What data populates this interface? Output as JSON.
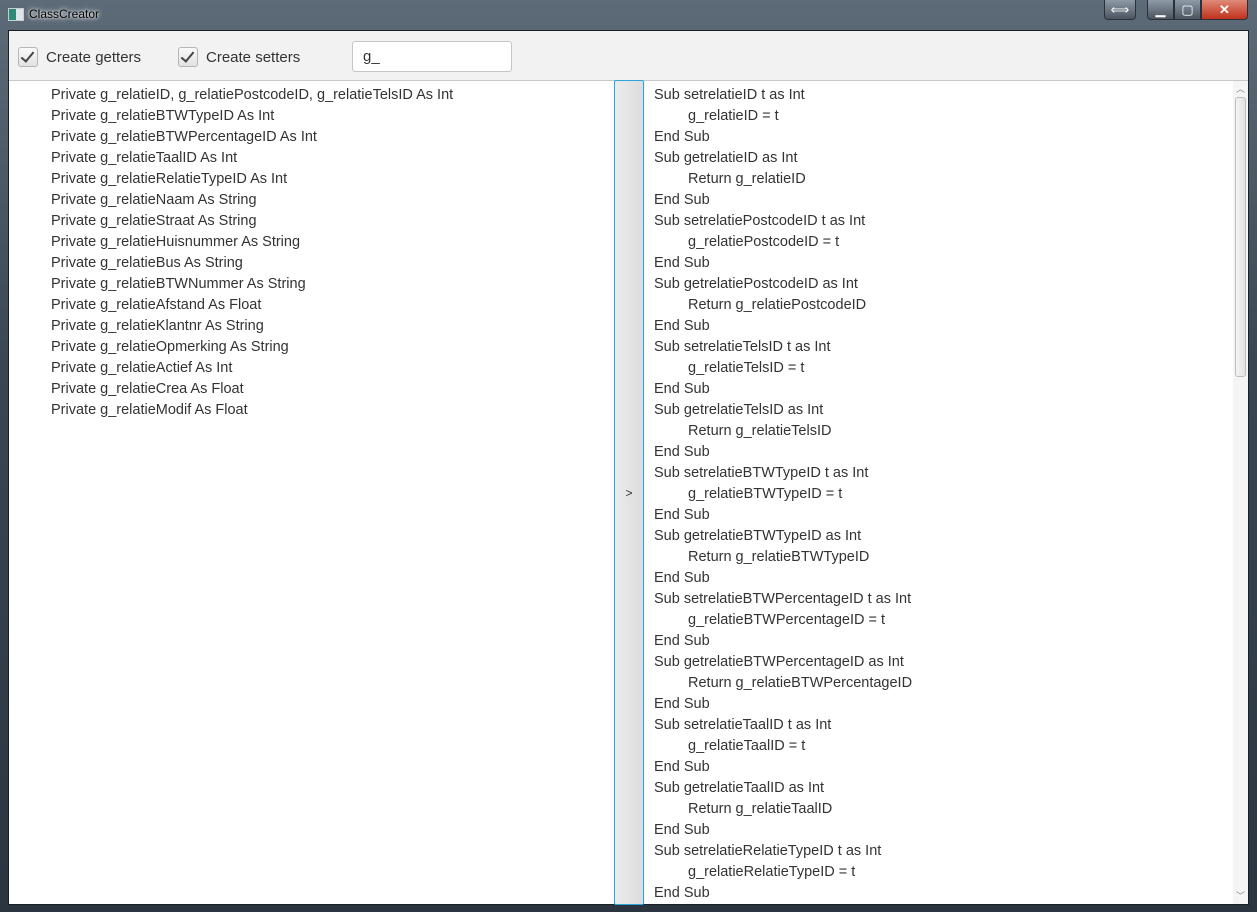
{
  "window": {
    "title": "ClassCreator"
  },
  "toolbar": {
    "getters_label": "Create getters",
    "getters_checked": true,
    "setters_label": "Create setters",
    "setters_checked": true,
    "prefix_value": "g_",
    "run_label": ">"
  },
  "declarations": [
    "Private g_relatieID, g_relatiePostcodeID, g_relatieTelsID As Int",
    "Private g_relatieBTWTypeID As Int",
    "Private g_relatieBTWPercentageID As Int",
    "Private g_relatieTaalID As Int",
    "Private g_relatieRelatieTypeID As Int",
    "Private g_relatieNaam As String",
    "Private g_relatieStraat As String",
    "Private g_relatieHuisnummer As String",
    "Private g_relatieBus As String",
    "Private g_relatieBTWNummer As String",
    "Private g_relatieAfstand As Float",
    "Private g_relatieKlantnr As String",
    "Private g_relatieOpmerking As String",
    "Private g_relatieActief As Int",
    "Private g_relatieCrea As Float",
    "Private g_relatieModif As Float"
  ],
  "output": [
    {
      "t": "Sub setrelatieID t as Int",
      "i": 0
    },
    {
      "t": "g_relatieID = t",
      "i": 1
    },
    {
      "t": "End Sub",
      "i": 0
    },
    {
      "t": "Sub getrelatieID as Int",
      "i": 0
    },
    {
      "t": "Return g_relatieID",
      "i": 1
    },
    {
      "t": "End Sub",
      "i": 0
    },
    {
      "t": "Sub setrelatiePostcodeID t as Int",
      "i": 0
    },
    {
      "t": "g_relatiePostcodeID = t",
      "i": 1
    },
    {
      "t": "End Sub",
      "i": 0
    },
    {
      "t": "Sub getrelatiePostcodeID as Int",
      "i": 0
    },
    {
      "t": "Return g_relatiePostcodeID",
      "i": 1
    },
    {
      "t": "End Sub",
      "i": 0
    },
    {
      "t": "Sub setrelatieTelsID t as Int",
      "i": 0
    },
    {
      "t": "g_relatieTelsID = t",
      "i": 1
    },
    {
      "t": "End Sub",
      "i": 0
    },
    {
      "t": "Sub getrelatieTelsID as Int",
      "i": 0
    },
    {
      "t": "Return g_relatieTelsID",
      "i": 1
    },
    {
      "t": "End Sub",
      "i": 0
    },
    {
      "t": "Sub setrelatieBTWTypeID t as Int",
      "i": 0
    },
    {
      "t": "g_relatieBTWTypeID = t",
      "i": 1
    },
    {
      "t": "End Sub",
      "i": 0
    },
    {
      "t": "Sub getrelatieBTWTypeID as Int",
      "i": 0
    },
    {
      "t": "Return g_relatieBTWTypeID",
      "i": 1
    },
    {
      "t": "End Sub",
      "i": 0
    },
    {
      "t": "Sub setrelatieBTWPercentageID t as Int",
      "i": 0
    },
    {
      "t": "g_relatieBTWPercentageID = t",
      "i": 1
    },
    {
      "t": "End Sub",
      "i": 0
    },
    {
      "t": "Sub getrelatieBTWPercentageID as Int",
      "i": 0
    },
    {
      "t": "Return g_relatieBTWPercentageID",
      "i": 1
    },
    {
      "t": "End Sub",
      "i": 0
    },
    {
      "t": "Sub setrelatieTaalID t as Int",
      "i": 0
    },
    {
      "t": "g_relatieTaalID = t",
      "i": 1
    },
    {
      "t": "End Sub",
      "i": 0
    },
    {
      "t": "Sub getrelatieTaalID as Int",
      "i": 0
    },
    {
      "t": "Return g_relatieTaalID",
      "i": 1
    },
    {
      "t": "End Sub",
      "i": 0
    },
    {
      "t": "Sub setrelatieRelatieTypeID t as Int",
      "i": 0
    },
    {
      "t": "g_relatieRelatieTypeID = t",
      "i": 1
    },
    {
      "t": "End Sub",
      "i": 0
    }
  ]
}
